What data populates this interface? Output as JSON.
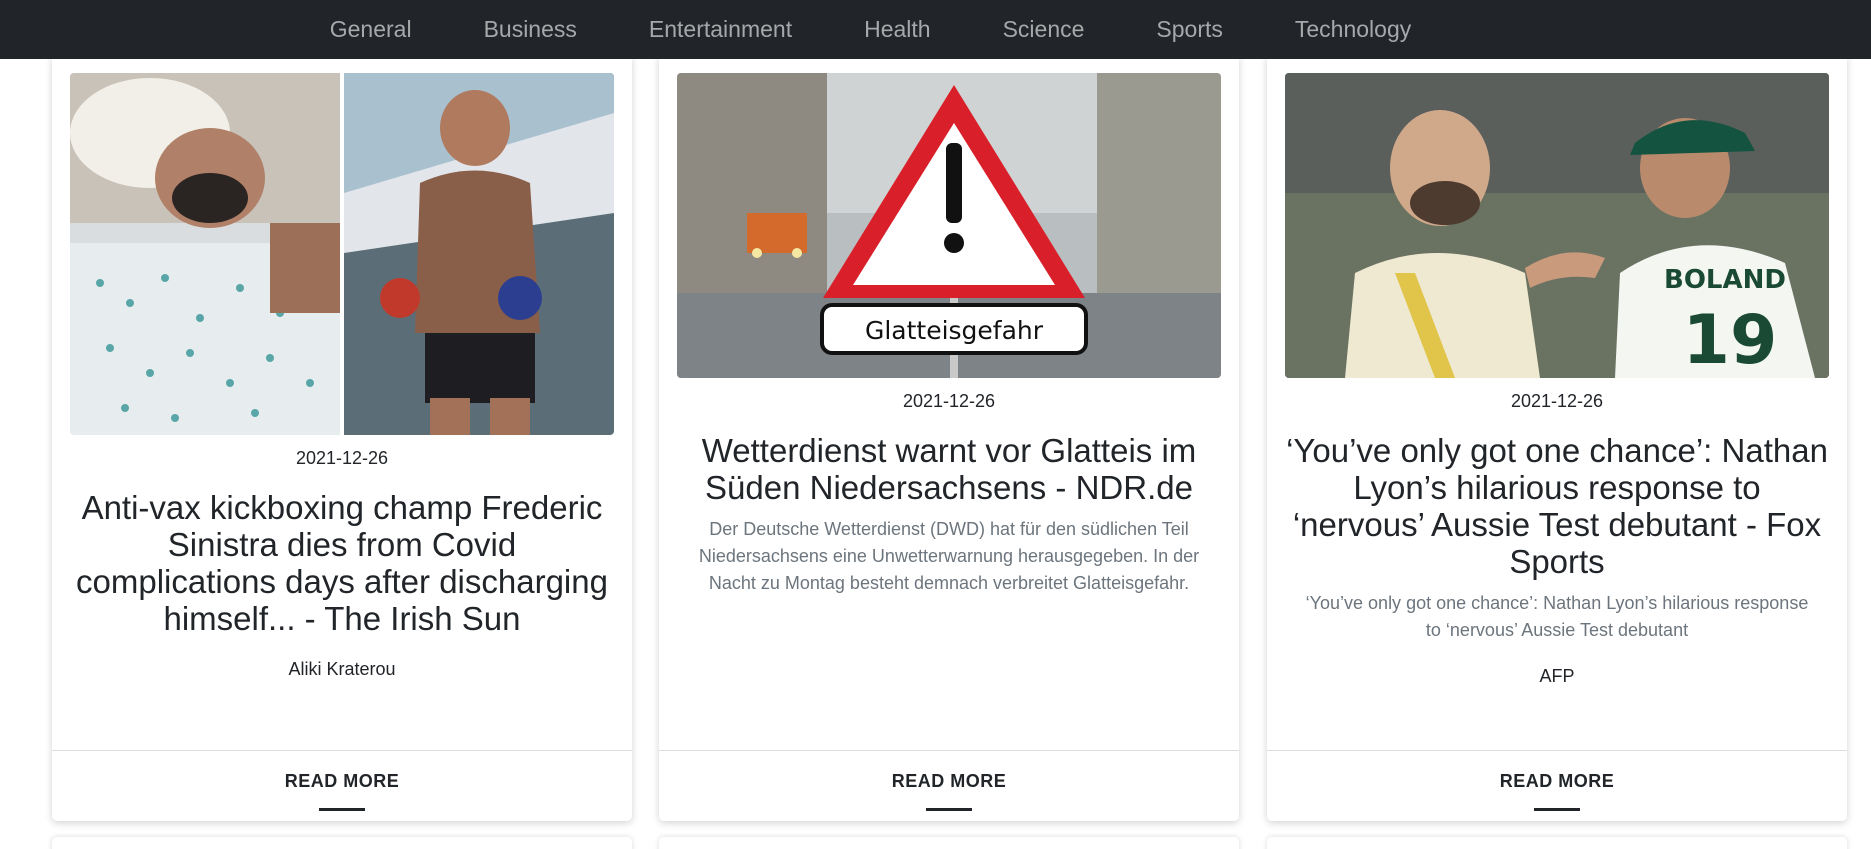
{
  "nav": {
    "items": [
      "General",
      "Business",
      "Entertainment",
      "Health",
      "Science",
      "Sports",
      "Technology"
    ]
  },
  "cards": [
    {
      "date": "2021-12-26",
      "title": "Anti-vax kickboxing champ Frederic Sinistra dies from Covid complications days after discharging himself... - The Irish Sun",
      "description": "",
      "author": "Aliki Kraterou",
      "read_more": "READ MORE",
      "image_icon": "fighter-photo"
    },
    {
      "date": "2021-12-26",
      "title": "Wetterdienst warnt vor Glatteis im Süden Niedersachsens - NDR.de",
      "description": "Der Deutsche Wetterdienst (DWD) hat für den südlichen Teil Niedersachsens eine Unwetterwarnung herausgegeben. In der Nacht zu Montag besteht demnach verbreitet Glatteisgefahr.",
      "author": "",
      "read_more": "READ MORE",
      "image_icon": "warning-sign-photo",
      "image_sign_text": "Glatteisgefahr"
    },
    {
      "date": "2021-12-26",
      "title": "‘You’ve only got one chance’: Nathan Lyon’s hilarious response to ‘nervous’ Aussie Test debutant - Fox Sports",
      "description": "‘You’ve only got one chance’: Nathan Lyon’s hilarious response to ‘nervous’ Aussie Test debutant",
      "author": "AFP",
      "read_more": "READ MORE",
      "image_icon": "cricketers-photo",
      "image_jersey_text": "BOLAND",
      "image_jersey_number": "19"
    }
  ],
  "colors": {
    "navbar_bg": "#212529",
    "nav_text": "#a6a8aa",
    "text_dark": "#212529",
    "text_muted": "#6c757d"
  }
}
